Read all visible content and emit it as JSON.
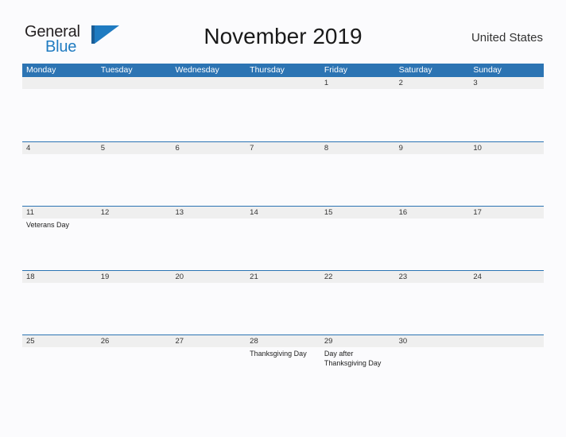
{
  "brand": {
    "name_part1": "General",
    "name_part2": "Blue",
    "flag_icon": "flag-triangle-icon"
  },
  "header": {
    "title": "November 2019",
    "country": "United States"
  },
  "colors": {
    "header_blue": "#2c74b3",
    "brand_blue": "#1f7bc1",
    "daynum_band": "#efefef",
    "page_background": "#fbfbfd",
    "text": "#333333"
  },
  "calendar": {
    "weekdays": [
      "Monday",
      "Tuesday",
      "Wednesday",
      "Thursday",
      "Friday",
      "Saturday",
      "Sunday"
    ],
    "weeks": [
      [
        {
          "num": "",
          "event": ""
        },
        {
          "num": "",
          "event": ""
        },
        {
          "num": "",
          "event": ""
        },
        {
          "num": "",
          "event": ""
        },
        {
          "num": "1",
          "event": ""
        },
        {
          "num": "2",
          "event": ""
        },
        {
          "num": "3",
          "event": ""
        }
      ],
      [
        {
          "num": "4",
          "event": ""
        },
        {
          "num": "5",
          "event": ""
        },
        {
          "num": "6",
          "event": ""
        },
        {
          "num": "7",
          "event": ""
        },
        {
          "num": "8",
          "event": ""
        },
        {
          "num": "9",
          "event": ""
        },
        {
          "num": "10",
          "event": ""
        }
      ],
      [
        {
          "num": "11",
          "event": "Veterans Day"
        },
        {
          "num": "12",
          "event": ""
        },
        {
          "num": "13",
          "event": ""
        },
        {
          "num": "14",
          "event": ""
        },
        {
          "num": "15",
          "event": ""
        },
        {
          "num": "16",
          "event": ""
        },
        {
          "num": "17",
          "event": ""
        }
      ],
      [
        {
          "num": "18",
          "event": ""
        },
        {
          "num": "19",
          "event": ""
        },
        {
          "num": "20",
          "event": ""
        },
        {
          "num": "21",
          "event": ""
        },
        {
          "num": "22",
          "event": ""
        },
        {
          "num": "23",
          "event": ""
        },
        {
          "num": "24",
          "event": ""
        }
      ],
      [
        {
          "num": "25",
          "event": ""
        },
        {
          "num": "26",
          "event": ""
        },
        {
          "num": "27",
          "event": ""
        },
        {
          "num": "28",
          "event": "Thanksgiving Day"
        },
        {
          "num": "29",
          "event": "Day after\nThanksgiving Day"
        },
        {
          "num": "30",
          "event": ""
        },
        {
          "num": "",
          "event": ""
        }
      ]
    ]
  }
}
